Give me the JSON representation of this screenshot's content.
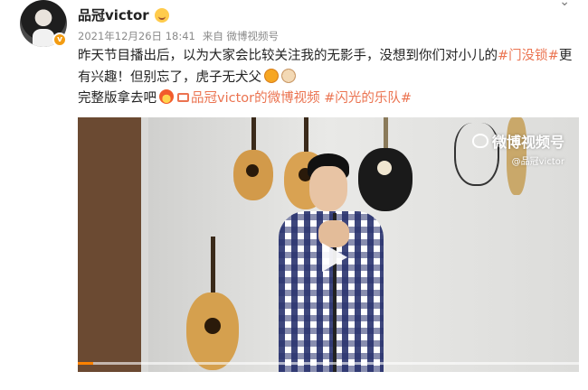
{
  "post": {
    "username": "品冠victor",
    "date": "2021年12月26日 18:41",
    "source": "来自 微博视频号",
    "text_part1": "昨天节目播出后，以为大家会比较关注我的无影手，没想到你们对小儿的",
    "hashtag1": "#门没锁#",
    "text_part2": "更有兴趣！但别忘了，虎子无犬父",
    "line3_prefix": "完整版拿去吧",
    "link_text": "品冠victor的微博视频",
    "hashtag2": "#闪光的乐队#"
  },
  "video": {
    "watermark_main": "微博视频号",
    "watermark_sub": "@品冠victor",
    "progress_fraction": 0.03
  },
  "icons": {
    "avatar_badge": "v-verified-icon",
    "name_badge": "smile-badge-icon",
    "menu": "chevron-down-icon",
    "emoji1": "tiger-emoji-icon",
    "emoji2": "dog-emoji-icon",
    "emoji3": "fire-emoji-icon",
    "link": "video-link-icon",
    "play": "play-icon"
  },
  "colors": {
    "hashtag": "#eb7350",
    "progress": "#ff8200",
    "verified": "#f39c12"
  }
}
